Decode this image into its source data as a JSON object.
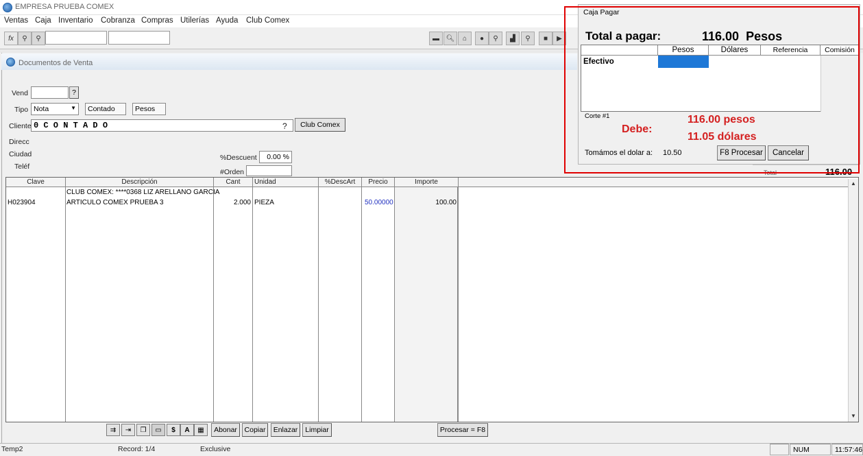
{
  "app": {
    "title": "EMPRESA PRUEBA COMEX"
  },
  "menu": [
    "Ventas",
    "Caja",
    "Inventario",
    "Cobranza",
    "Compras",
    "Utilerías",
    "Ayuda",
    "Club Comex"
  ],
  "toolbar": {
    "fx_label": "fx"
  },
  "document": {
    "title": "Documentos de Venta",
    "labels": {
      "vend": "Vend",
      "tipo": "Tipo",
      "cliente": "Cliente",
      "direcc": "Direcc",
      "ciudad": "Ciudad",
      "telef": "Teléf",
      "descuento": "%Descuent",
      "orden": "#Orden"
    },
    "vend_value": "",
    "vend_help": "?",
    "tipo_value": "Nota",
    "condicion": "Contado",
    "moneda": "Pesos",
    "cliente_value": "0 C O N T A D O",
    "cliente_help": "?",
    "club_button": "Club Comex",
    "descuento_value": "0.00 %",
    "orden_value": ""
  },
  "grid": {
    "headers": [
      "Clave",
      "Descripción",
      "Cant",
      "Unidad",
      "%DescArt",
      "Precio",
      "Importe"
    ],
    "rows": [
      {
        "clave": "",
        "descripcion": "CLUB COMEX: ****0368 LIZ ARELLANO GARCIA",
        "cant": "",
        "unidad": "",
        "descart": "",
        "precio": "",
        "importe": ""
      },
      {
        "clave": "H023904",
        "descripcion": "ARTICULO COMEX PRUEBA 3",
        "cant": "2.000",
        "unidad": "PIEZA",
        "descart": "",
        "precio": "50.00000",
        "importe": "100.00"
      }
    ]
  },
  "bottom": {
    "abonar": "Abonar",
    "copiar": "Copiar",
    "enlazar": "Enlazar",
    "limpiar": "Limpiar",
    "procesar": "Procesar = F8",
    "dollar": "$",
    "letter_a": "A"
  },
  "status": {
    "left": "Temp2",
    "record": "Record: 1/4",
    "mode": "Exclusive",
    "num": "NUM",
    "time": "11:57:46"
  },
  "behind": {
    "total_label": "Total",
    "total_value": "116.00"
  },
  "pay": {
    "title": "Caja Pagar",
    "total_label": "Total a pagar:",
    "total_value": "116.00  Pesos",
    "headers": [
      "Pesos",
      "Dólares",
      "Referencia",
      "Comisión"
    ],
    "row_label": "Efectivo",
    "corte": "Corte #1",
    "debe_label": "Debe:",
    "debe_pesos": "116.00 pesos",
    "debe_dolares": "11.05 dólares",
    "tc_label": "Tomámos el dolar a:",
    "tc_value": "10.50",
    "procesar_button": "F8 Procesar",
    "cancelar_button": "Cancelar"
  },
  "colors": {
    "accent_red": "#e00000",
    "debe_red": "#d42020",
    "selection_blue": "#1e78d7",
    "precio_blue": "#2030c0"
  }
}
